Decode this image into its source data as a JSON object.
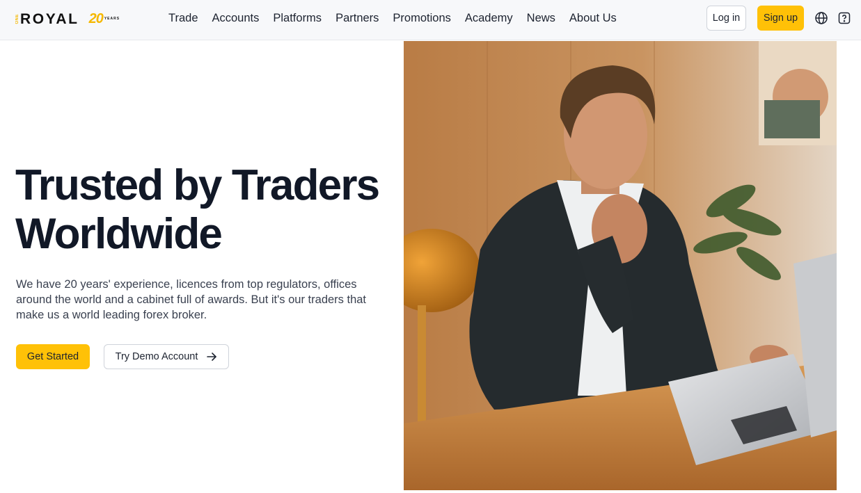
{
  "header": {
    "logo": {
      "one": "ONE",
      "brand": "ROYAL",
      "anniversary_number": "20",
      "anniversary_word": "YEARS"
    },
    "nav": [
      "Trade",
      "Accounts",
      "Platforms",
      "Partners",
      "Promotions",
      "Academy",
      "News",
      "About Us"
    ],
    "login_label": "Log in",
    "signup_label": "Sign up",
    "icons": {
      "language": "globe-icon",
      "help": "help-icon"
    }
  },
  "hero": {
    "title_line1": "Trusted by Traders",
    "title_line2": "Worldwide",
    "description": "We have 20 years' experience, licences from top regulators, offices around the world and a cabinet full of awards. But it's our traders that make us a world leading forex broker.",
    "primary_cta": "Get Started",
    "secondary_cta": "Try Demo Account"
  },
  "colors": {
    "accent": "#ffc107",
    "text_dark": "#111827",
    "header_bg": "#f7f8fa"
  }
}
